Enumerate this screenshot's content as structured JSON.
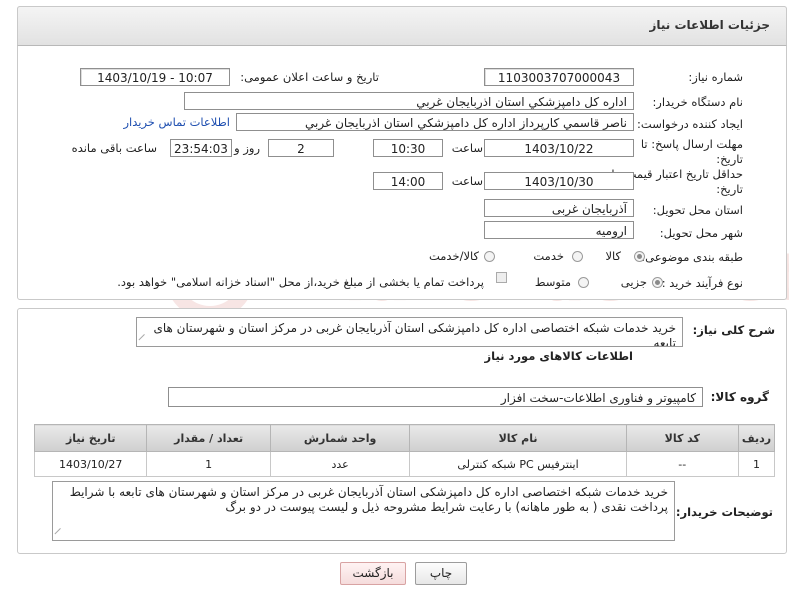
{
  "header": {
    "title": "جزئیات اطلاعات نیاز"
  },
  "form": {
    "need_number_label": "شماره نیاز:",
    "need_number": "1103003707000043",
    "announce_label": "تاریخ و ساعت اعلان عمومی:",
    "announce_value": "1403/10/19 - 10:07",
    "buyer_org_label": "نام دستگاه خریدار:",
    "buyer_org": "اداره کل دامپزشکي استان اذربايجان غربي",
    "creator_label": "ایجاد کننده درخواست:",
    "creator": "ناصر قاسمي کارپرداز اداره کل دامپزشکي استان اذربايجان غربي",
    "contact_link": "اطلاعات تماس خریدار",
    "deadline_label": "مهلت ارسال پاسخ: تا تاریخ:",
    "deadline_date": "1403/10/22",
    "time_label": "ساعت",
    "deadline_time": "10:30",
    "days_value": "2",
    "days_label": "روز و",
    "remaining_time": "23:54:03",
    "remaining_label": "ساعت باقی مانده",
    "validity_label": "حداقل تاریخ اعتبار قیمت: تا تاریخ:",
    "validity_date": "1403/10/30",
    "validity_time": "14:00",
    "province_label": "استان محل تحویل:",
    "province": "آذربایجان غربی",
    "city_label": "شهر محل تحویل:",
    "city": "ارومیه",
    "category_label": "طبقه بندی موضوعی:",
    "category_options": [
      "کالا",
      "خدمت",
      "کالا/خدمت"
    ],
    "category_selected": "کالا",
    "purchase_label": "نوع فرآیند خرید :",
    "purchase_options": [
      "جزیی",
      "متوسط"
    ],
    "purchase_selected": "جزیی",
    "payment_note": "پرداخت تمام یا بخشی از مبلغ خرید،از محل \"اسناد خزانه اسلامی\" خواهد بود."
  },
  "details": {
    "summary_label": "شرح کلی نیاز:",
    "summary": "خرید خدمات شبکه اختصاصی اداره کل دامپزشکی استان آذربایجان غربی در مرکز استان و شهرستان های تابعه",
    "goods_info_title": "اطلاعات کالاهای مورد نیاز",
    "goods_group_label": "گروه کالا:",
    "goods_group": "کامپیوتر و فناوری اطلاعات-سخت افزار",
    "table": {
      "headers": [
        "ردیف",
        "کد کالا",
        "نام کالا",
        "واحد شمارش",
        "تعداد / مقدار",
        "تاریخ نیاز"
      ],
      "rows": [
        [
          "1",
          "--",
          "اینترفیس PC شبکه کنترلی",
          "عدد",
          "1",
          "1403/10/27"
        ]
      ]
    },
    "buyer_notes_label": "توضیحات خریدار:",
    "buyer_notes": "خرید خدمات شبکه اختصاصی اداره کل دامپزشکی استان آذربایجان غربی در مرکز استان و شهرستان های تابعه با شرایط پرداخت نقدی ( به طور ماهانه) با رعایت شرایط مشروحه ذیل و لیست پیوست در دو برگ"
  },
  "buttons": {
    "print": "چاپ",
    "back": "بازگشت"
  },
  "watermark": {
    "text": "AriaTender.net"
  }
}
